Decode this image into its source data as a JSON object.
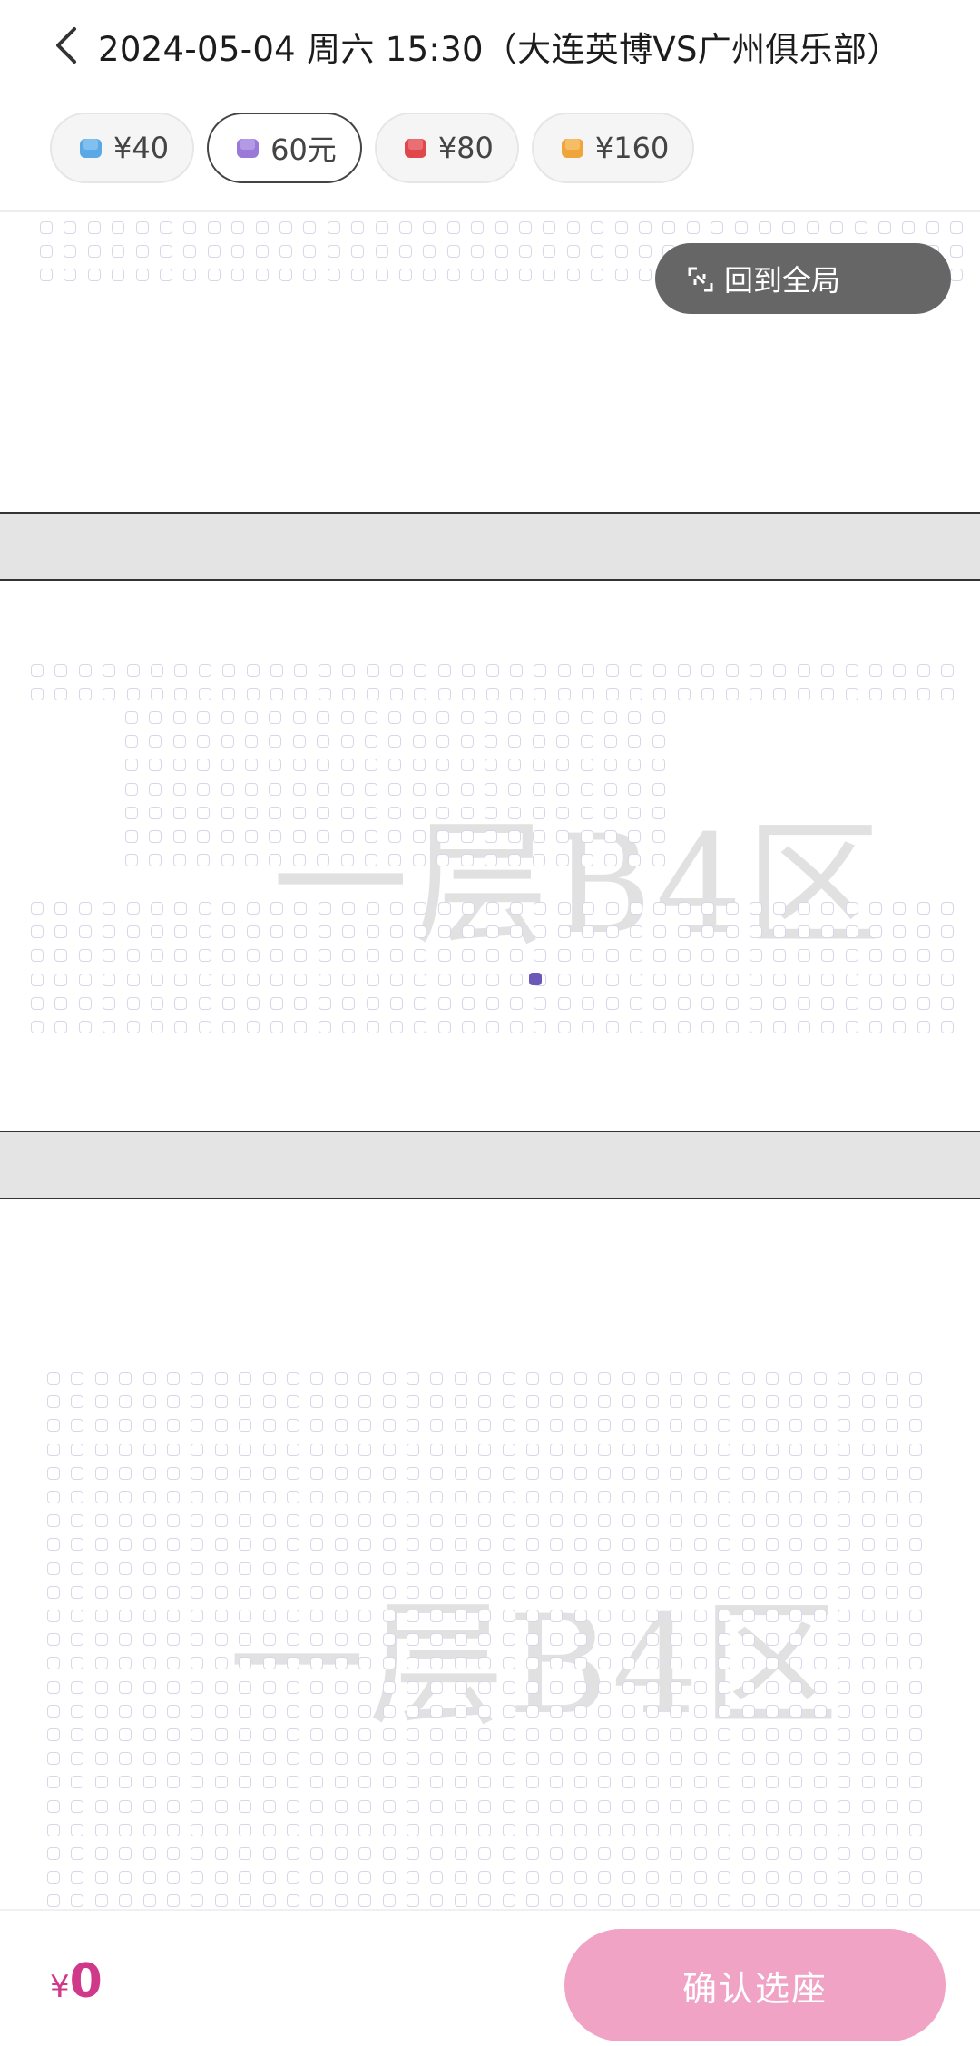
{
  "header": {
    "title": "2024-05-04 周六 15:30（大连英博VS广州俱乐部）"
  },
  "price_filters": [
    {
      "label": "¥40",
      "color": "#5aa9e6",
      "icon": "seat-icon",
      "selected": false
    },
    {
      "label": "60元",
      "color": "#9a79d8",
      "icon": "seat-icon",
      "selected": true
    },
    {
      "label": "¥80",
      "color": "#e0474c",
      "icon": "seat-icon",
      "selected": false
    },
    {
      "label": "¥160",
      "color": "#f0a53a",
      "icon": "seat-icon",
      "selected": false
    }
  ],
  "seatmap": {
    "reset_view_label": "回到全局",
    "zone_label": "一层B4区",
    "available_seat_color": "#6c58b8",
    "unavailable_seat_color": "#d6d8e8"
  },
  "bottom_bar": {
    "currency": "¥",
    "total": "0",
    "confirm_label": "确认选座"
  },
  "colors": {
    "accent": "#d0398a",
    "confirm_button": "#f0a3c4"
  }
}
